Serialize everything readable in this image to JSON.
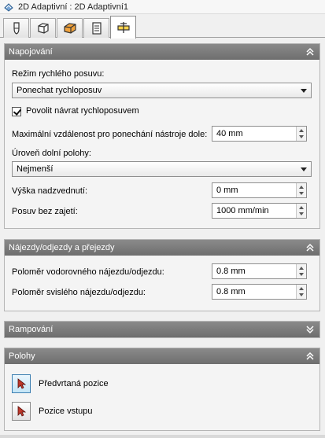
{
  "window": {
    "title": "2D Adaptivní : 2D Adaptivní1"
  },
  "tabs": [
    {
      "icon": "tool-icon"
    },
    {
      "icon": "cube-icon"
    },
    {
      "icon": "stock-icon"
    },
    {
      "icon": "heights-icon"
    },
    {
      "icon": "passes-icon"
    }
  ],
  "linking": {
    "title": "Napojování",
    "retract_mode_label": "Režim rychlého posuvu:",
    "retract_mode_value": "Ponechat rychloposuv",
    "allow_rapid_retract_label": "Povolit návrat rychloposuvem",
    "allow_rapid_retract_checked": true,
    "max_stay_down_label": "Maximální vzdálenost pro ponechání nástroje dole:",
    "max_stay_down_value": "40 mm",
    "lower_level_label": "Úroveň dolní polohy:",
    "lower_level_value": "Nejmenší",
    "lift_height_label": "Výška nadzvednutí:",
    "lift_height_value": "0 mm",
    "feedrate_label": "Posuv bez zajetí:",
    "feedrate_value": "1000 mm/min"
  },
  "leads": {
    "title": "Nájezdy/odjezdy a přejezdy",
    "horizontal_radius_label": "Poloměr vodorovného nájezdu/odjezdu:",
    "horizontal_radius_value": "0.8 mm",
    "vertical_radius_label": "Poloměr svislého nájezdu/odjezdu:",
    "vertical_radius_value": "0.8 mm"
  },
  "ramping": {
    "title": "Rampování"
  },
  "positions": {
    "title": "Polohy",
    "predrill_label": "Předvrtaná pozice",
    "entry_label": "Pozice vstupu"
  },
  "colors": {
    "section_header": "#7d7d7d",
    "active_tab": "#ffffff",
    "pointer": "#c0392b"
  }
}
